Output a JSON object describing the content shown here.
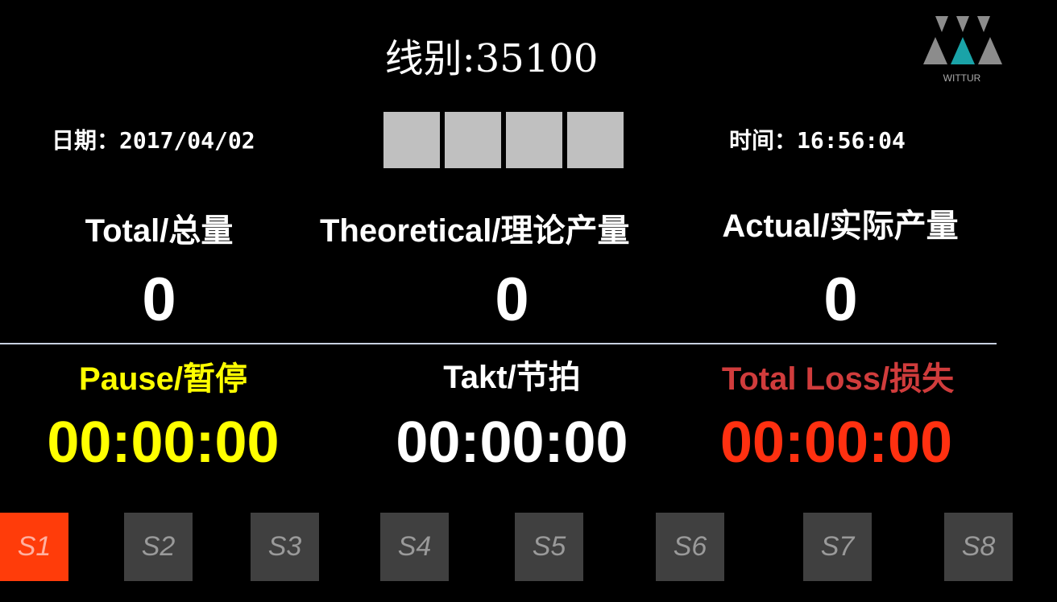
{
  "header": {
    "line_label": "线别:35100",
    "logo_text": "WITTUR"
  },
  "date": {
    "label": "日期：",
    "value": "2017/04/02"
  },
  "time": {
    "label": "时间：",
    "value": "16:56:04"
  },
  "status_boxes": {
    "count": 4,
    "color": "#c0c0c0"
  },
  "metrics": {
    "total": {
      "label": "Total/总量",
      "value": "0"
    },
    "theoretical": {
      "label": "Theoretical/理论产量",
      "value": "0"
    },
    "actual": {
      "label": "Actual/实际产量",
      "value": "0"
    }
  },
  "timers": {
    "pause": {
      "label": "Pause/暂停",
      "value": "00:00:00",
      "color": "#ffff00"
    },
    "takt": {
      "label": "Takt/节拍",
      "value": "00:00:00",
      "color": "#ffffff"
    },
    "loss": {
      "label": "Total Loss/损失",
      "label_color": "#d03c3c",
      "value": "00:00:00",
      "value_color": "#ff3010"
    }
  },
  "stations": [
    {
      "label": "S1",
      "active": true
    },
    {
      "label": "S2",
      "active": false
    },
    {
      "label": "S3",
      "active": false
    },
    {
      "label": "S4",
      "active": false
    },
    {
      "label": "S5",
      "active": false
    },
    {
      "label": "S6",
      "active": false
    },
    {
      "label": "S7",
      "active": false
    },
    {
      "label": "S8",
      "active": false
    }
  ],
  "colors": {
    "background": "#000000",
    "active_station": "#ff3c0a",
    "inactive_station": "#404040"
  }
}
